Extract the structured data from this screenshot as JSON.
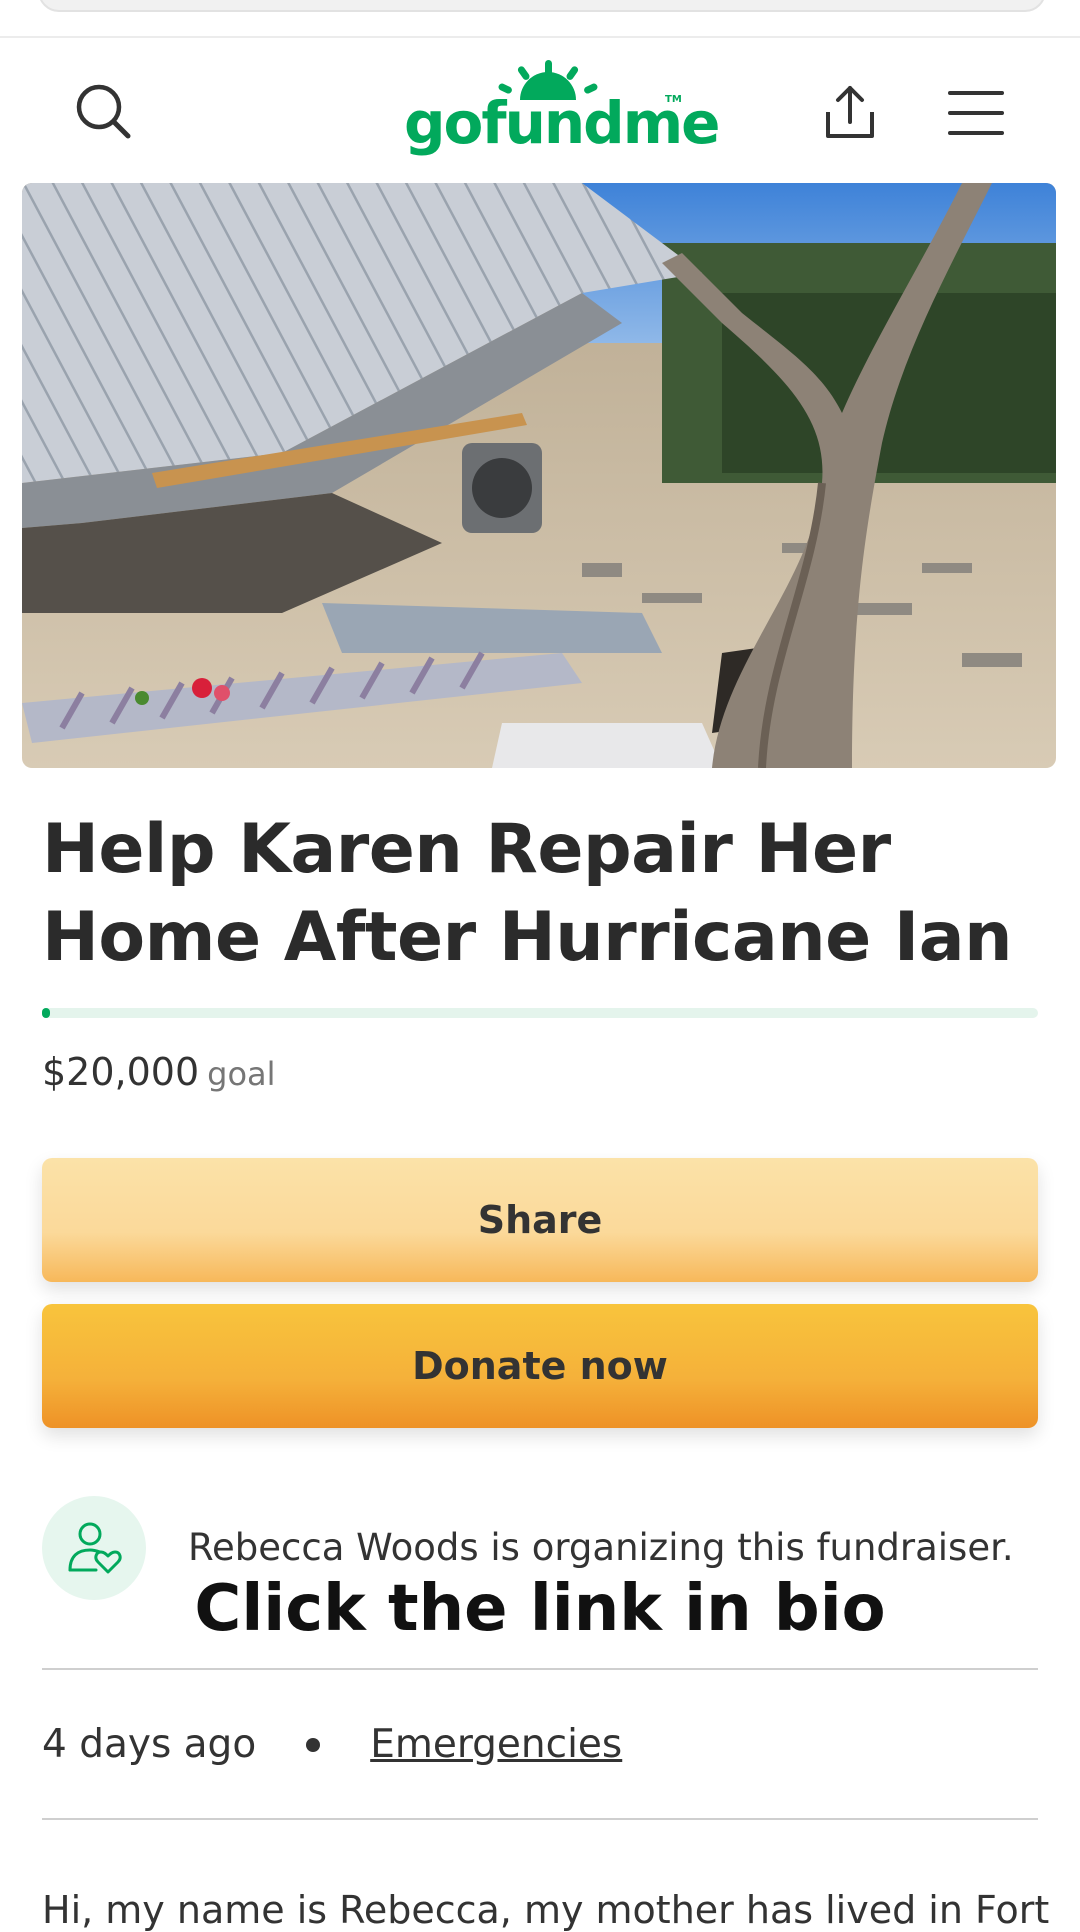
{
  "brand": {
    "logo_text": "gofundme",
    "tm": "TM",
    "color": "#02a95c"
  },
  "header": {
    "icons": [
      "search-icon",
      "share-upload-icon",
      "hamburger-menu-icon"
    ]
  },
  "hero": {
    "alt": "Hurricane-damaged house with collapsed metal roof, debris and a tree"
  },
  "campaign": {
    "title": "Help Karen Repair Her Home After Hurricane Ian",
    "raised_fraction": 0.008,
    "goal_amount": "$20,000",
    "goal_label": "goal"
  },
  "actions": {
    "share_label": "Share",
    "donate_label": "Donate now"
  },
  "organizer": {
    "text": "Rebecca Woods is organizing this fundraiser.",
    "icon": "person-heart-icon"
  },
  "overlay_caption": "Click the link in bio",
  "meta": {
    "posted": "4 days ago",
    "category": "Emergencies"
  },
  "story": {
    "first_line": "Hi, my name is Rebecca, my mother has lived in Fort"
  },
  "colors": {
    "accent": "#02a95c",
    "share_button": "#fbd99a",
    "donate_button": "#f5b13a"
  }
}
